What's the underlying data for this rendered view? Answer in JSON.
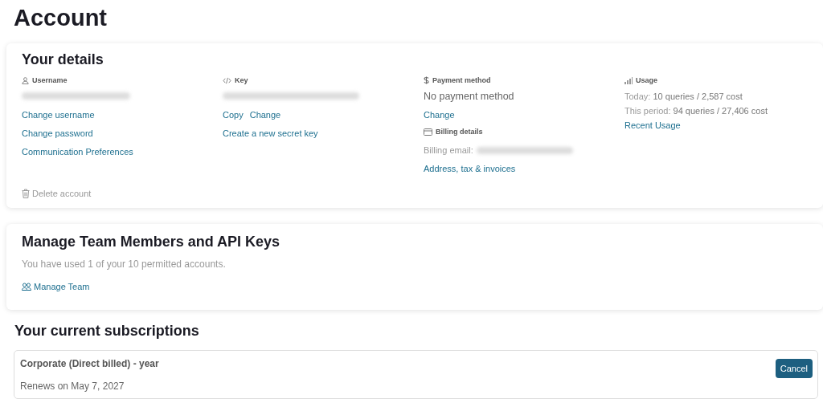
{
  "title": "Account",
  "details": {
    "title": "Your details",
    "columns": [
      {
        "kind": "user",
        "heading": "Username",
        "items": [
          {
            "kind": "redacted"
          },
          {
            "kind": "link",
            "text": "Change username"
          },
          {
            "kind": "link",
            "text": "Change password"
          },
          {
            "kind": "link",
            "text": "Communication Preferences"
          }
        ]
      },
      {
        "kind": "code",
        "heading": "Key",
        "items": [
          {
            "kind": "redacted"
          },
          {
            "kind": "links",
            "links": [
              "Copy",
              "Change"
            ]
          },
          {
            "kind": "link",
            "text": "Create a new secret key"
          }
        ]
      },
      {
        "kind": "dollar",
        "heading": "Payment method",
        "items": [
          {
            "kind": "text",
            "text": "No payment method"
          },
          {
            "kind": "link",
            "text": "Change"
          },
          {
            "kind": "subheading",
            "text": "Billing details"
          },
          {
            "kind": "field",
            "label": "Billing email:"
          },
          {
            "kind": "link",
            "text": "Address, tax & invoices"
          }
        ]
      },
      {
        "kind": "chart",
        "heading": "Usage",
        "items": [
          {
            "kind": "stat",
            "label": "Today:",
            "value": "10 queries / 2,587 cost"
          },
          {
            "kind": "stat",
            "label": "This period:",
            "value": "94 queries / 27,406 cost"
          },
          {
            "kind": "link",
            "text": "Recent Usage"
          }
        ]
      }
    ],
    "delete": "Delete account"
  },
  "team": {
    "title": "Manage Team Members and API Keys",
    "note": "You have used 1 of your 10 permitted accounts.",
    "link": "Manage Team"
  },
  "subscriptions": {
    "title": "Your current subscriptions",
    "items": [
      {
        "name": "Corporate (Direct billed) - year",
        "renews": "Renews on May 7, 2027",
        "action": "Cancel"
      }
    ]
  }
}
